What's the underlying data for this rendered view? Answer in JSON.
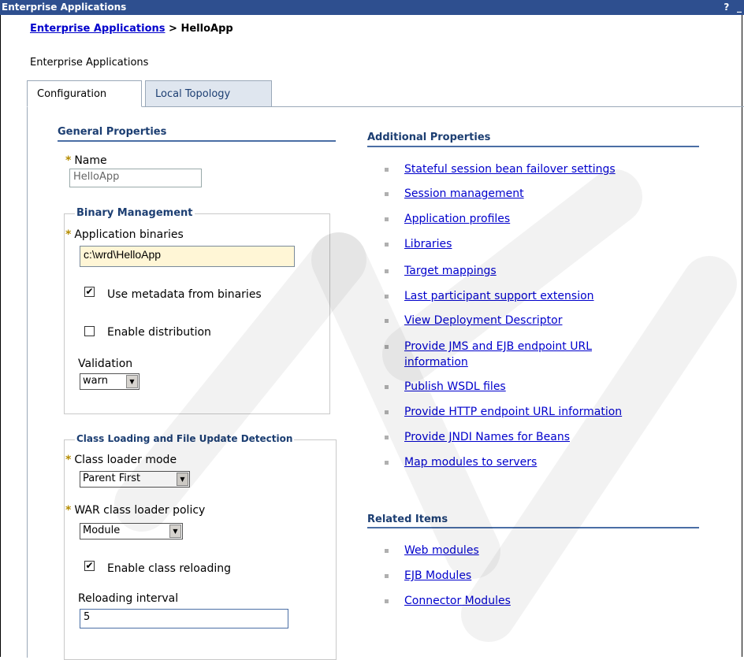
{
  "window": {
    "title": "Enterprise Applications",
    "help_icon": "?",
    "minimize_icon": "_"
  },
  "breadcrumb": {
    "link": "Enterprise Applications",
    "separator": ">",
    "current": "HelloApp"
  },
  "subtitle": "Enterprise Applications",
  "tabs": [
    {
      "label": "Configuration",
      "active": true
    },
    {
      "label": "Local Topology",
      "active": false
    }
  ],
  "general": {
    "heading": "General Properties",
    "name_label": "Name",
    "name_value": "HelloApp",
    "binary": {
      "legend": "Binary Management",
      "app_binaries_label": "Application binaries",
      "app_binaries_value": "c:\\wrd\\HelloApp",
      "use_metadata_label": "Use metadata from binaries",
      "use_metadata_checked": true,
      "enable_distribution_label": "Enable distribution",
      "enable_distribution_checked": false,
      "validation_label": "Validation",
      "validation_value": "warn"
    },
    "classloading": {
      "legend": "Class Loading and File Update Detection",
      "class_loader_mode_label": "Class loader mode",
      "class_loader_mode_value": "Parent First",
      "war_policy_label": "WAR class loader policy",
      "war_policy_value": "Module",
      "enable_reloading_label": "Enable class reloading",
      "enable_reloading_checked": true,
      "reloading_interval_label": "Reloading interval",
      "reloading_interval_value": "5"
    }
  },
  "additional": {
    "heading": "Additional Properties",
    "items": [
      "Stateful session bean failover settings",
      "Session management",
      "Application profiles",
      "Libraries",
      "Target mappings",
      "Last participant support extension",
      "View Deployment Descriptor",
      "Provide JMS and EJB endpoint URL",
      "information",
      "Publish WSDL files",
      "Provide HTTP endpoint URL information",
      "Provide JNDI Names for Beans",
      "Map modules to servers"
    ]
  },
  "related": {
    "heading": "Related Items",
    "items": [
      "Web modules",
      "EJB Modules",
      "Connector Modules"
    ]
  },
  "colors": {
    "titlebar": "#2e4f8f",
    "link": "#0000cc",
    "section": "#1c3e72",
    "required_star": "#b58c00",
    "required_bg": "#fff6d6"
  }
}
